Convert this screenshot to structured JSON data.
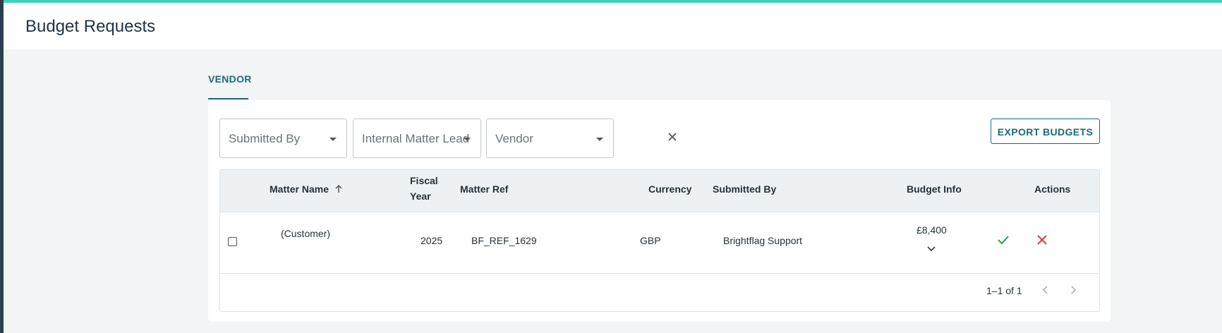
{
  "page": {
    "title": "Budget Requests"
  },
  "tabs": [
    {
      "label": "VENDOR",
      "active": true
    }
  ],
  "filters": [
    {
      "label": "Submitted By"
    },
    {
      "label": "Internal Matter Lead"
    },
    {
      "label": "Vendor"
    }
  ],
  "toolbar": {
    "export_label": "EXPORT BUDGETS"
  },
  "table": {
    "headers": {
      "matter_name": "Matter Name",
      "fiscal_year_line1": "Fiscal",
      "fiscal_year_line2": "Year",
      "matter_ref": "Matter Ref",
      "currency": "Currency",
      "submitted_by": "Submitted By",
      "budget_info": "Budget Info",
      "actions": "Actions"
    },
    "sort": {
      "column": "Matter Name",
      "direction": "ascending"
    },
    "rows": [
      {
        "matter_name": "(Customer)",
        "fiscal_year": "2025",
        "matter_ref": "BF_REF_1629",
        "currency": "GBP",
        "submitted_by": "Brightflag Support",
        "budget_info": "£8,400"
      }
    ]
  },
  "pagination": {
    "range_text": "1–1 of 1"
  },
  "colors": {
    "accent": "#1a6b79",
    "top_bar": "#3fd2b8",
    "approve": "#2e9e4f",
    "reject": "#d63c3c"
  }
}
